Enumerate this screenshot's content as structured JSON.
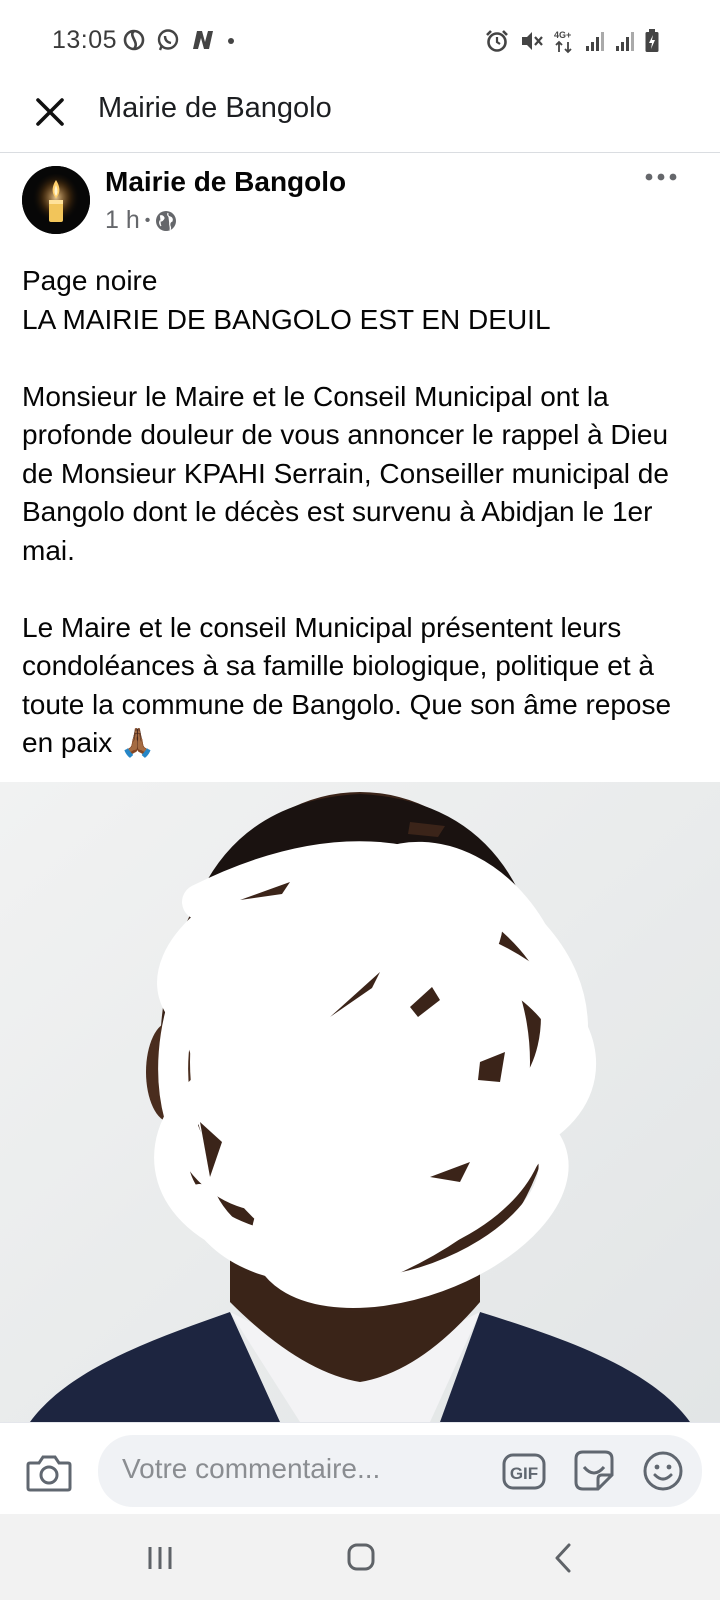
{
  "status_bar": {
    "time": "13:05",
    "left_icons": [
      "swirl-app-icon",
      "whatsapp-icon",
      "n-app-icon",
      "notification-dot-icon"
    ],
    "right_icons": [
      "alarm-icon",
      "mute-icon",
      "network-4g-icon",
      "signal-icon",
      "signal-icon",
      "battery-charging-icon"
    ],
    "network_label": "4G+"
  },
  "topbar": {
    "title": "Mairie de Bangolo",
    "close_icon": "close-icon"
  },
  "post": {
    "author": "Mairie de Bangolo",
    "avatar_icon": "candle-icon",
    "time": "1 h",
    "separator": "•",
    "audience_icon": "globe-icon",
    "more_icon": "more-dots-icon",
    "line1": "Page noire",
    "line2": "LA MAIRIE DE BANGOLO EST EN DEUIL",
    "paragraph1": "Monsieur le Maire et le Conseil Municipal ont la profonde douleur de vous annoncer le rappel à Dieu de Monsieur KPAHI Serrain, Conseiller municipal de Bangolo dont le décès est survenu à Abidjan le 1er mai.",
    "paragraph2": "Le Maire et le conseil Municipal présentent leurs condoléances à sa famille biologique, politique et à toute la commune de Bangolo. Que son âme repose en paix",
    "emoji": "🙏🏾",
    "image": "portrait-photo-face-scribbled"
  },
  "comment_bar": {
    "placeholder": "Votre commentaire...",
    "camera_icon": "camera-icon",
    "gif_label": "GIF",
    "sticker_icon": "sticker-icon",
    "emoji_icon": "smiley-icon"
  },
  "nav_bar": {
    "icons": [
      "recents-icon",
      "home-icon",
      "back-icon"
    ]
  }
}
